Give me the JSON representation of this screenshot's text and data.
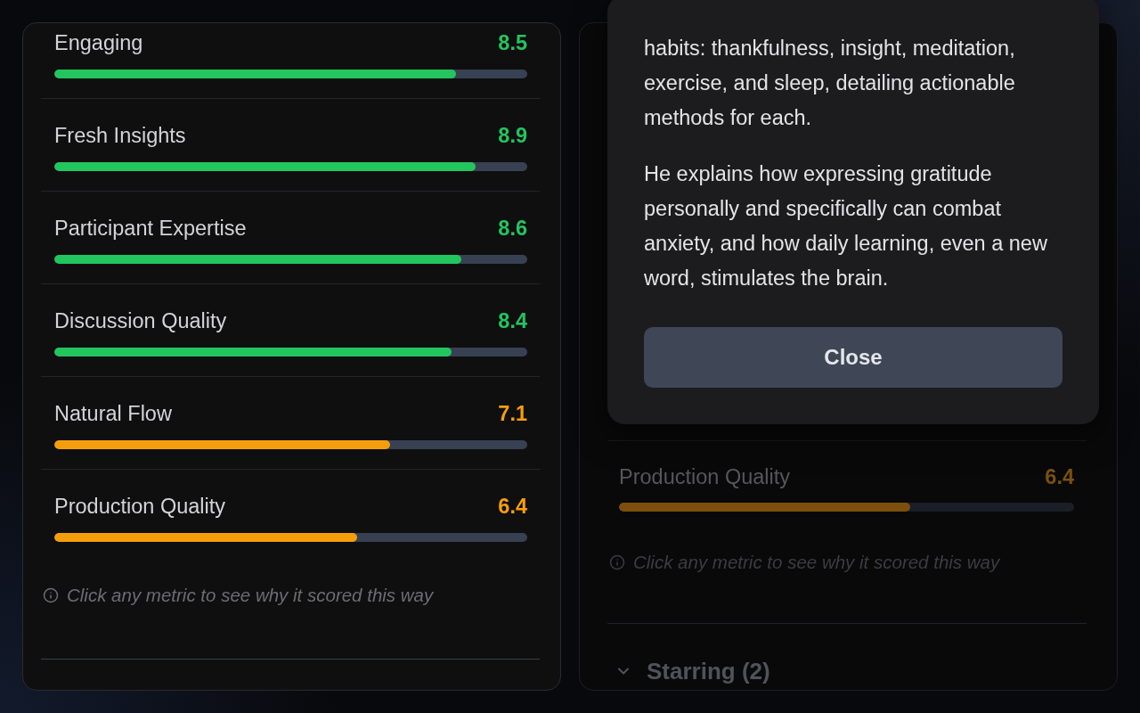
{
  "score_panel": {
    "metrics": [
      {
        "name": "Engaging",
        "score": "8.5",
        "level": 0.85,
        "color": "#22c55e"
      },
      {
        "name": "Fresh Insights",
        "score": "8.9",
        "level": 0.89,
        "color": "#22c55e"
      },
      {
        "name": "Participant Expertise",
        "score": "8.6",
        "level": 0.86,
        "color": "#22c55e"
      },
      {
        "name": "Discussion Quality",
        "score": "8.4",
        "level": 0.84,
        "color": "#22c55e"
      },
      {
        "name": "Natural Flow",
        "score": "7.1",
        "level": 0.71,
        "color": "#f59e0b"
      },
      {
        "name": "Production Quality",
        "score": "6.4",
        "level": 0.64,
        "color": "#f59e0b"
      }
    ],
    "hint": "Click any metric to see why it scored this way"
  },
  "dialog": {
    "paragraphs": [
      "habits: thankfulness, insight, meditation, exercise, and sleep, detailing actionable methods for each.",
      "He explains how expressing gratitude personally and specifically can combat anxiety, and how daily learning, even a new word, stimulates the brain."
    ],
    "button": "Close"
  },
  "background_panel": {
    "dimmed": true,
    "metrics": [
      {
        "name": "Production Quality",
        "score": "6.4",
        "level": 0.64,
        "color": "#7c500c"
      }
    ],
    "hint": "Click any metric to see why it scored this way",
    "sections": [
      {
        "title": "Starring (2)"
      }
    ]
  }
}
